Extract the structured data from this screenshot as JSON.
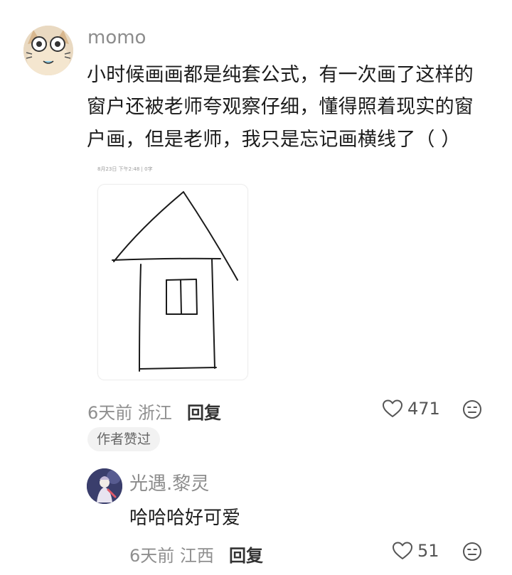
{
  "comment": {
    "username": "momo",
    "lines": [
      "小时候画画都是纯套公式，有一次画了这样的",
      "窗户还被老师夸观察仔细，懂得照着现实的窗",
      "户画，但是老师，我只是忘记画横线了（ ）"
    ],
    "attachment": {
      "photo_meta": "8月23日 下午2:48  |  0字"
    },
    "time": "6天前",
    "location": "浙江",
    "reply_label": "回复",
    "like_count": "471",
    "author_liked_badge": "作者赞过"
  },
  "reply": {
    "username": "光遇.黎灵",
    "text": "哈哈哈好可爱",
    "time": "6天前",
    "location": "江西",
    "reply_label": "回复",
    "like_count": "51"
  },
  "icons": {
    "like": "heart-outline-icon",
    "dislike": "meh-face-icon"
  },
  "colors": {
    "secondary_text": "#8f8f8f",
    "primary_text": "#1c1c1c",
    "badge_bg": "#f2f2f2"
  }
}
